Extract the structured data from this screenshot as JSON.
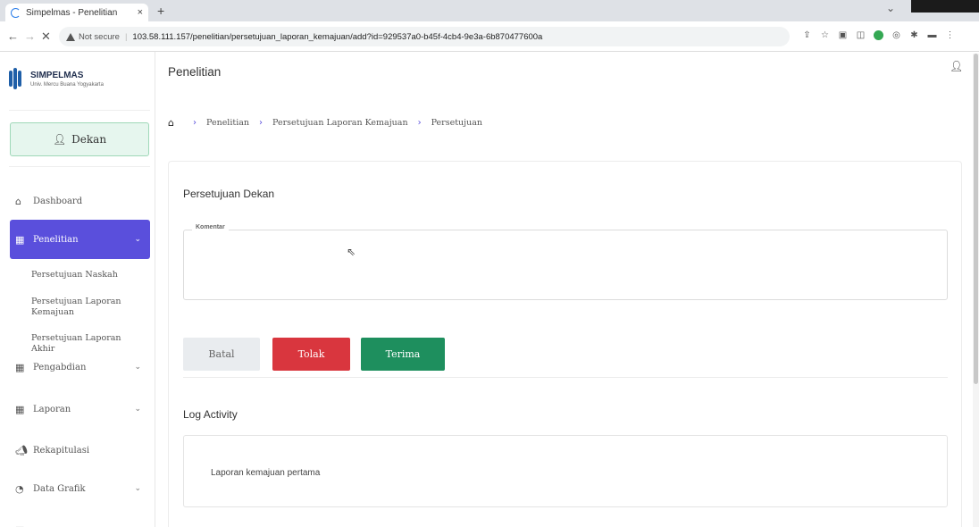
{
  "browser": {
    "tab_title": "Simpelmas - Penelitian",
    "tab_close": "×",
    "new_tab": "+",
    "not_secure": "Not secure",
    "url": "103.58.111.157/penelitian/persetujuan_laporan_kemajuan/add?id=929537a0-b45f-4cb4-9e3a-6b870477600a"
  },
  "sidebar": {
    "brand_name": "SIMPELMAS",
    "brand_sub": "Univ. Mercu Buana Yogyakarta",
    "role": "Dekan",
    "menu": {
      "dashboard": "Dashboard",
      "penelitian": "Penelitian",
      "pengabdian": "Pengabdian",
      "laporan": "Laporan",
      "rekapitulasi": "Rekapitulasi",
      "data_grafik": "Data Grafik"
    },
    "submenu": [
      "Persetujuan Naskah",
      "Persetujuan Laporan Kemajuan",
      "Persetujuan Laporan Akhir"
    ]
  },
  "header": {
    "title": "Penelitian"
  },
  "breadcrumb": [
    "Penelitian",
    "Persetujuan Laporan Kemajuan",
    "Persetujuan"
  ],
  "form": {
    "section_title": "Persetujuan Dekan",
    "komentar_label": "Komentar",
    "komentar_value": "",
    "btn_batal": "Batal",
    "btn_tolak": "Tolak",
    "btn_terima": "Terima"
  },
  "log": {
    "title": "Log Activity",
    "entry": "Laporan kemajuan pertama"
  },
  "colors": {
    "accent": "#5a4fdc",
    "danger": "#d9363e",
    "success": "#1e8f5e"
  }
}
